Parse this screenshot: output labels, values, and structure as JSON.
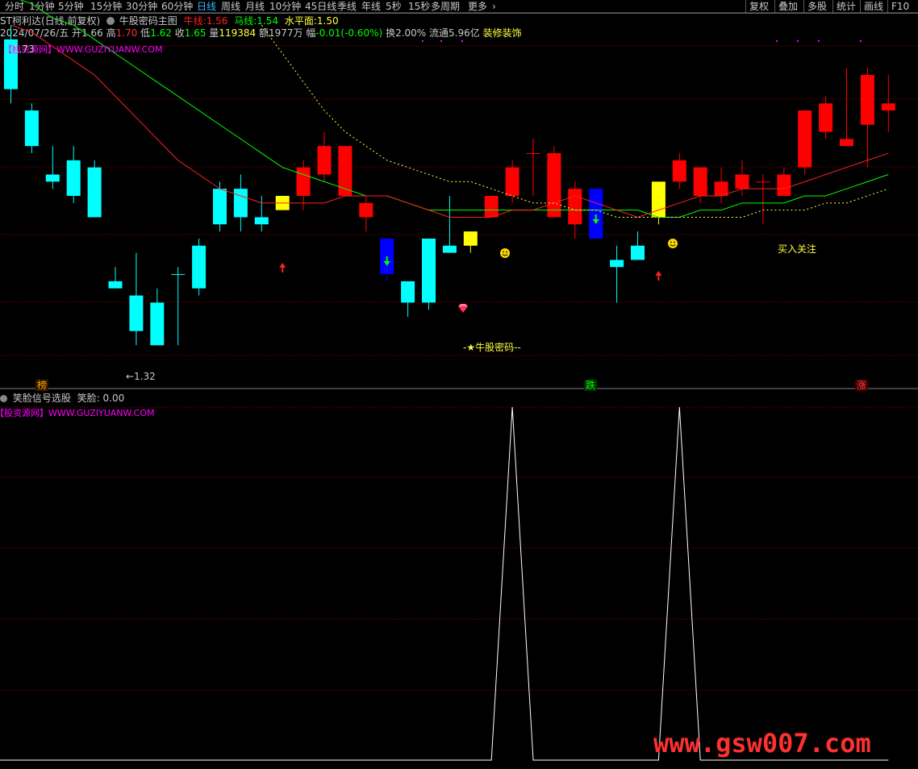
{
  "toolbar": {
    "left_items": [
      "分时",
      "1分钟",
      "5分钟",
      "15分钟",
      "30分钟",
      "60分钟",
      "日线",
      "周线",
      "月线",
      "10分钟",
      "45日线",
      "季线",
      "年线",
      "5秒",
      "15秒",
      "多周期",
      "更多"
    ],
    "active": "日线",
    "more_arrow": "›",
    "right_items": [
      "复权",
      "叠加",
      "多股",
      "统计",
      "画线",
      "F10"
    ]
  },
  "header": {
    "title": "ST柯利达(日线,前复权)",
    "indicator_name": "牛股密码主图",
    "niu_label": "牛线:",
    "niu_value": "1.56",
    "ma_label": "马线:",
    "ma_value": "1.54",
    "level_label": "水平面:",
    "level_value": "1.50"
  },
  "info": {
    "date": "2024/07/26/五",
    "open_label": "开",
    "open": "1.66",
    "high_label": "高",
    "high": "1.70",
    "low_label": "低",
    "low": "1.62",
    "close_label": "收",
    "close": "1.65",
    "vol_label": "量",
    "vol": "119384",
    "amt_label": "额",
    "amt": "1977万",
    "chg_label": "幅",
    "chg": "-0.01(-0.60%)",
    "turnover": "换2.00%",
    "float": "流通5.96亿",
    "decor": "装修装饰"
  },
  "watermark_text": "【股资源网】WWW.GUZIYUANW.COM",
  "price_labels": {
    "max": "1.73",
    "min": "←1.32"
  },
  "annotations": {
    "niugu": "-★牛股密码--",
    "buy": "买入关注"
  },
  "events": {
    "bang": "榜",
    "die": "跌",
    "zhang": "涨"
  },
  "sub_panel": {
    "title": "笑脸信号选股",
    "value_label": "笑脸:",
    "value": "0.00"
  },
  "footer_watermark": "www.gsw007.com",
  "colors": {
    "bg": "#000000",
    "up": "#ff0000",
    "down": "#00ffff",
    "blue": "#0000ff",
    "yellow": "#ffff00",
    "niu": "#ff2020",
    "ma": "#00ff00",
    "level": "#ffff40",
    "grid": "#8b0000",
    "magenta": "#ff00ff",
    "signal": "#ffffff"
  },
  "chart_data": {
    "type": "candlestick",
    "ylim": [
      1.3,
      1.76
    ],
    "candles": [
      {
        "o": 1.75,
        "c": 1.68,
        "h": 1.77,
        "l": 1.66,
        "col": "down"
      },
      {
        "o": 1.65,
        "c": 1.6,
        "h": 1.66,
        "l": 1.59,
        "col": "down"
      },
      {
        "o": 1.56,
        "c": 1.55,
        "h": 1.6,
        "l": 1.54,
        "col": "down"
      },
      {
        "o": 1.58,
        "c": 1.53,
        "h": 1.6,
        "l": 1.52,
        "col": "down"
      },
      {
        "o": 1.57,
        "c": 1.5,
        "h": 1.58,
        "l": 1.5,
        "col": "down"
      },
      {
        "o": 1.41,
        "c": 1.4,
        "h": 1.43,
        "l": 1.4,
        "col": "down"
      },
      {
        "o": 1.39,
        "c": 1.34,
        "h": 1.45,
        "l": 1.32,
        "col": "down"
      },
      {
        "o": 1.38,
        "c": 1.32,
        "h": 1.4,
        "l": 1.32,
        "col": "down"
      },
      {
        "o": 1.42,
        "c": 1.42,
        "h": 1.43,
        "l": 1.32,
        "col": "down"
      },
      {
        "o": 1.46,
        "c": 1.4,
        "h": 1.47,
        "l": 1.39,
        "col": "down"
      },
      {
        "o": 1.54,
        "c": 1.49,
        "h": 1.55,
        "l": 1.48,
        "col": "down"
      },
      {
        "o": 1.54,
        "c": 1.5,
        "h": 1.56,
        "l": 1.48,
        "col": "down"
      },
      {
        "o": 1.5,
        "c": 1.49,
        "h": 1.53,
        "l": 1.48,
        "col": "down"
      },
      {
        "o": 1.51,
        "c": 1.53,
        "h": 1.53,
        "l": 1.51,
        "col": "yellow"
      },
      {
        "o": 1.53,
        "c": 1.57,
        "h": 1.58,
        "l": 1.51,
        "col": "up"
      },
      {
        "o": 1.56,
        "c": 1.6,
        "h": 1.62,
        "l": 1.55,
        "col": "up"
      },
      {
        "o": 1.53,
        "c": 1.6,
        "h": 1.6,
        "l": 1.53,
        "col": "up"
      },
      {
        "o": 1.5,
        "c": 1.52,
        "h": 1.53,
        "l": 1.48,
        "col": "up"
      },
      {
        "o": 1.47,
        "c": 1.42,
        "h": 1.47,
        "l": 1.41,
        "col": "blue"
      },
      {
        "o": 1.41,
        "c": 1.38,
        "h": 1.41,
        "l": 1.36,
        "col": "down"
      },
      {
        "o": 1.38,
        "c": 1.47,
        "h": 1.47,
        "l": 1.37,
        "col": "down"
      },
      {
        "o": 1.46,
        "c": 1.45,
        "h": 1.53,
        "l": 1.45,
        "col": "down"
      },
      {
        "o": 1.46,
        "c": 1.48,
        "h": 1.48,
        "l": 1.45,
        "col": "yellow"
      },
      {
        "o": 1.5,
        "c": 1.53,
        "h": 1.53,
        "l": 1.5,
        "col": "up"
      },
      {
        "o": 1.53,
        "c": 1.57,
        "h": 1.58,
        "l": 1.52,
        "col": "up"
      },
      {
        "o": 1.59,
        "c": 1.59,
        "h": 1.61,
        "l": 1.53,
        "col": "up"
      },
      {
        "o": 1.5,
        "c": 1.59,
        "h": 1.6,
        "l": 1.5,
        "col": "up"
      },
      {
        "o": 1.49,
        "c": 1.54,
        "h": 1.55,
        "l": 1.47,
        "col": "up"
      },
      {
        "o": 1.54,
        "c": 1.47,
        "h": 1.54,
        "l": 1.47,
        "col": "blue"
      },
      {
        "o": 1.44,
        "c": 1.43,
        "h": 1.46,
        "l": 1.38,
        "col": "down"
      },
      {
        "o": 1.46,
        "c": 1.44,
        "h": 1.48,
        "l": 1.44,
        "col": "down"
      },
      {
        "o": 1.5,
        "c": 1.55,
        "h": 1.55,
        "l": 1.49,
        "col": "yellow"
      },
      {
        "o": 1.55,
        "c": 1.58,
        "h": 1.59,
        "l": 1.54,
        "col": "up"
      },
      {
        "o": 1.53,
        "c": 1.57,
        "h": 1.57,
        "l": 1.52,
        "col": "up"
      },
      {
        "o": 1.53,
        "c": 1.55,
        "h": 1.57,
        "l": 1.52,
        "col": "up"
      },
      {
        "o": 1.54,
        "c": 1.56,
        "h": 1.58,
        "l": 1.53,
        "col": "up"
      },
      {
        "o": 1.55,
        "c": 1.55,
        "h": 1.56,
        "l": 1.49,
        "col": "up"
      },
      {
        "o": 1.53,
        "c": 1.56,
        "h": 1.57,
        "l": 1.53,
        "col": "up"
      },
      {
        "o": 1.57,
        "c": 1.65,
        "h": 1.65,
        "l": 1.56,
        "col": "up"
      },
      {
        "o": 1.62,
        "c": 1.66,
        "h": 1.67,
        "l": 1.61,
        "col": "up"
      },
      {
        "o": 1.6,
        "c": 1.61,
        "h": 1.71,
        "l": 1.6,
        "col": "up"
      },
      {
        "o": 1.63,
        "c": 1.7,
        "h": 1.71,
        "l": 1.57,
        "col": "up"
      },
      {
        "o": 1.66,
        "c": 1.65,
        "h": 1.7,
        "l": 1.62,
        "col": "up"
      }
    ],
    "niu_line": [
      1.77,
      1.76,
      1.74,
      1.72,
      1.7,
      1.67,
      1.64,
      1.61,
      1.58,
      1.56,
      1.54,
      1.53,
      1.52,
      1.52,
      1.52,
      1.52,
      1.53,
      1.53,
      1.53,
      1.52,
      1.51,
      1.5,
      1.5,
      1.5,
      1.51,
      1.51,
      1.52,
      1.53,
      1.52,
      1.51,
      1.5,
      1.51,
      1.52,
      1.53,
      1.53,
      1.54,
      1.54,
      1.54,
      1.55,
      1.56,
      1.57,
      1.58,
      1.59
    ],
    "ma_line": [
      1.81,
      1.8,
      1.78,
      1.77,
      1.75,
      1.73,
      1.71,
      1.69,
      1.67,
      1.65,
      1.63,
      1.61,
      1.59,
      1.57,
      1.56,
      1.55,
      1.54,
      1.53,
      1.53,
      1.52,
      1.51,
      1.51,
      1.51,
      1.51,
      1.51,
      1.51,
      1.51,
      1.51,
      1.51,
      1.51,
      1.51,
      1.5,
      1.5,
      1.51,
      1.51,
      1.52,
      1.52,
      1.52,
      1.53,
      1.53,
      1.54,
      1.55,
      1.56
    ],
    "level_line": [
      null,
      null,
      null,
      null,
      null,
      null,
      null,
      null,
      null,
      null,
      null,
      null,
      1.77,
      1.73,
      1.69,
      1.65,
      1.62,
      1.6,
      1.58,
      1.57,
      1.56,
      1.55,
      1.55,
      1.54,
      1.53,
      1.52,
      1.52,
      1.51,
      1.51,
      1.5,
      1.5,
      1.5,
      1.5,
      1.5,
      1.5,
      1.5,
      1.51,
      1.51,
      1.51,
      1.52,
      1.52,
      1.53,
      1.54
    ],
    "smile_signal": [
      0,
      0,
      0,
      0,
      0,
      0,
      0,
      0,
      0,
      0,
      0,
      0,
      0,
      0,
      0,
      0,
      0,
      0,
      0,
      0,
      0,
      0,
      0,
      0,
      1,
      0,
      0,
      0,
      0,
      0,
      0,
      0,
      1,
      0,
      0,
      0,
      0,
      0,
      0,
      0,
      0,
      0,
      0
    ]
  }
}
